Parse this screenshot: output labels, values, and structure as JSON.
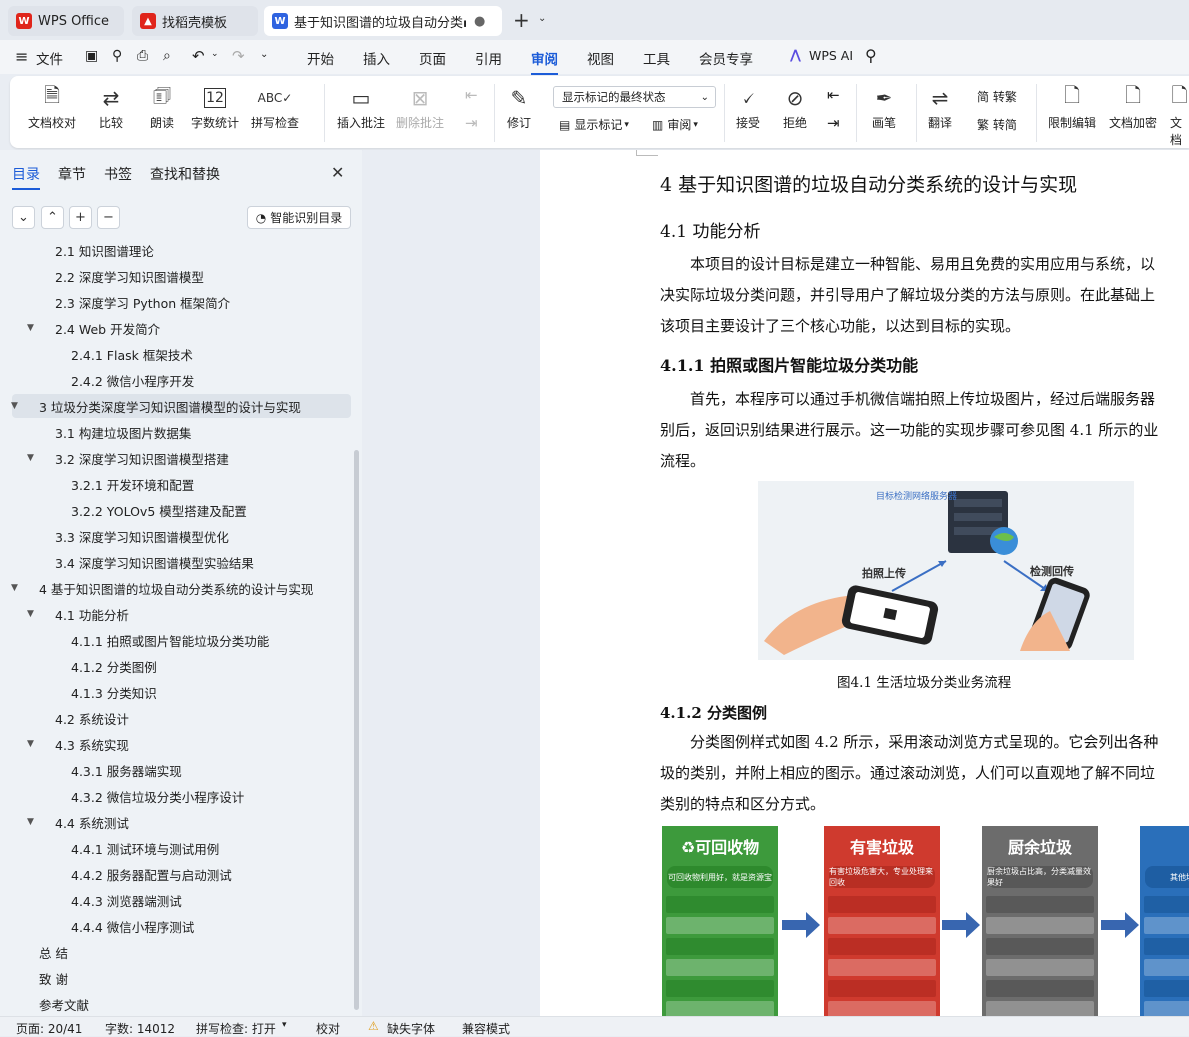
{
  "tabs": {
    "wps": "WPS Office",
    "template": "找稻壳模板",
    "doc": "基于知识图谱的垃圾自动分类▪"
  },
  "menu": {
    "file": "文件",
    "items": [
      "开始",
      "插入",
      "页面",
      "引用",
      "审阅",
      "视图",
      "工具",
      "会员专享"
    ],
    "ai": "WPS AI"
  },
  "ribbon": {
    "proof": "文档校对",
    "compare": "比较",
    "read": "朗读",
    "wordcount": "字数统计",
    "spell": "拼写检查",
    "insert_comment": "插入批注",
    "delete_comment": "删除批注",
    "revise": "修订",
    "show_mode": "显示标记的最终状态",
    "show_marks": "显示标记",
    "review": "审阅",
    "accept": "接受",
    "reject": "拒绝",
    "pen": "画笔",
    "translate": "翻译",
    "to_trad": "简 转繁",
    "to_simp": "繁 转简",
    "restrict": "限制编辑",
    "encrypt": "文档加密",
    "more": "文档"
  },
  "sidebar": {
    "tabs": [
      "目录",
      "章节",
      "书签",
      "查找和替换"
    ],
    "smart": "智能识别目录",
    "toc": [
      {
        "label": "2.1  知识图谱理论",
        "level": 2,
        "arrow": ""
      },
      {
        "label": "2.2  深度学习知识图谱模型",
        "level": 2,
        "arrow": ""
      },
      {
        "label": "2.3  深度学习 Python 框架简介",
        "level": 2,
        "arrow": ""
      },
      {
        "label": "2.4 Web 开发简介",
        "level": 2,
        "arrow": "▼"
      },
      {
        "label": "2.4.1 Flask 框架技术",
        "level": 3,
        "arrow": ""
      },
      {
        "label": "2.4.2  微信小程序开发",
        "level": 3,
        "arrow": ""
      },
      {
        "label": "3  垃圾分类深度学习知识图谱模型的设计与实现",
        "level": 1,
        "arrow": "▼",
        "hl": true
      },
      {
        "label": "3.1  构建垃圾图片数据集",
        "level": 2,
        "arrow": ""
      },
      {
        "label": "3.2  深度学习知识图谱模型搭建",
        "level": 2,
        "arrow": "▼"
      },
      {
        "label": "3.2.1  开发环境和配置",
        "level": 3,
        "arrow": ""
      },
      {
        "label": "3.2.2 YOLOv5 模型搭建及配置",
        "level": 3,
        "arrow": ""
      },
      {
        "label": "3.3  深度学习知识图谱模型优化",
        "level": 2,
        "arrow": ""
      },
      {
        "label": "3.4  深度学习知识图谱模型实验结果",
        "level": 2,
        "arrow": ""
      },
      {
        "label": "4  基于知识图谱的垃圾自动分类系统的设计与实现",
        "level": 1,
        "arrow": "▼"
      },
      {
        "label": "4.1  功能分析",
        "level": 2,
        "arrow": "▼"
      },
      {
        "label": "4.1.1  拍照或图片智能垃圾分类功能",
        "level": 3,
        "arrow": ""
      },
      {
        "label": "4.1.2  分类图例",
        "level": 3,
        "arrow": ""
      },
      {
        "label": "4.1.3  分类知识",
        "level": 3,
        "arrow": ""
      },
      {
        "label": "4.2  系统设计",
        "level": 2,
        "arrow": ""
      },
      {
        "label": "4.3  系统实现",
        "level": 2,
        "arrow": "▼"
      },
      {
        "label": "4.3.1  服务器端实现",
        "level": 3,
        "arrow": ""
      },
      {
        "label": "4.3.2  微信垃圾分类小程序设计",
        "level": 3,
        "arrow": ""
      },
      {
        "label": "4.4  系统测试",
        "level": 2,
        "arrow": "▼"
      },
      {
        "label": "4.4.1  测试环境与测试用例",
        "level": 3,
        "arrow": ""
      },
      {
        "label": "4.4.2  服务器配置与启动测试",
        "level": 3,
        "arrow": ""
      },
      {
        "label": "4.4.3  浏览器端测试",
        "level": 3,
        "arrow": ""
      },
      {
        "label": "4.4.4  微信小程序测试",
        "level": 3,
        "arrow": ""
      },
      {
        "label": "总    结",
        "level": 1,
        "arrow": ""
      },
      {
        "label": "致    谢",
        "level": 1,
        "arrow": ""
      },
      {
        "label": "参考文献",
        "level": 1,
        "arrow": ""
      }
    ]
  },
  "doc": {
    "h1": "4  基于知识图谱的垃圾自动分类系统的设计与实现",
    "h2": "4.1  功能分析",
    "p1": [
      "本项目的设计目标是建立一种智能、易用且免费的实用应用与系统，以",
      "决实际垃圾分类问题，并引导用户了解垃圾分类的方法与原则。在此基础上",
      "该项目主要设计了三个核心功能，以达到目标的实现。"
    ],
    "h3a": "4.1.1  拍照或图片智能垃圾分类功能",
    "p2": [
      "首先，本程序可以通过手机微信端拍照上传垃圾图片，经过后端服务器",
      "别后，返回识别结果进行展示。这一功能的实现步骤可参见图 4.1 所示的业",
      "流程。"
    ],
    "fig_labels": {
      "server": "目标检测网络服务器",
      "up": "拍照上传",
      "back": "检测回传"
    },
    "caption": "图4.1    生活垃圾分类业务流程",
    "h3b": "4.1.2  分类图例",
    "p3": [
      "分类图例样式如图 4.2 所示，采用滚动浏览方式呈现的。它会列出各种",
      "圾的类别，并附上相应的图示。通过滚动浏览，人们可以直观地了解不同垃",
      "类别的特点和区分方式。"
    ],
    "cards": [
      {
        "title": "♻可回收物",
        "sub": "可回收物利用好，就是资源宝",
        "color": "#3d9a3c",
        "row": "#2e8a2d"
      },
      {
        "title": "有害垃圾",
        "sub": "有害垃圾危害大，专业处理来回收",
        "color": "#cf3a2e",
        "row": "#b82e23"
      },
      {
        "title": "厨余垃圾",
        "sub": "厨余垃圾占比高，分类减量效果好",
        "color": "#6c6c6c",
        "row": "#585858"
      },
      {
        "title": "其",
        "sub": "其他垃圾是垃圾",
        "color": "#2a6fba",
        "row": "#1e5ea3"
      }
    ]
  },
  "status": {
    "page": "页面: 20/41",
    "words": "字数: 14012",
    "spell": "拼写检查: 打开",
    "proof": "校对",
    "font": "缺失字体",
    "compat": "兼容模式"
  }
}
